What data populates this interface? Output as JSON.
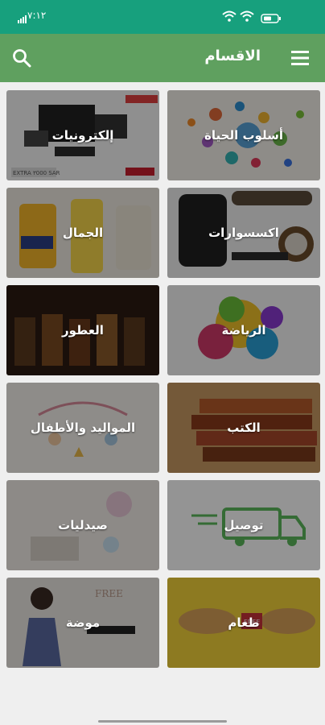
{
  "status": {
    "time": "٧:١٢",
    "battery_icon": "battery-icon",
    "wifi_icon": "wifi-icon",
    "signal_icon": "signal-icon"
  },
  "app_bar": {
    "title": "الاقسام",
    "search_icon": "search-icon",
    "menu_icon": "menu-icon"
  },
  "categories": [
    {
      "label": "أسلوب الحياة"
    },
    {
      "label": "إلكترونيات"
    },
    {
      "label": "اكسسوارات"
    },
    {
      "label": "الجمال"
    },
    {
      "label": "الرياضة"
    },
    {
      "label": "العطور"
    },
    {
      "label": "الكتب"
    },
    {
      "label": "المواليد والأطفال"
    },
    {
      "label": "توصيل"
    },
    {
      "label": "صيدليات"
    },
    {
      "label": "طعام"
    },
    {
      "label": "موضة"
    }
  ],
  "image_texts": {
    "electronics_sale": "EXTRA ٣000 SAR",
    "food_badge": "FREE",
    "fashion_sale": "FREE"
  },
  "colors": {
    "status_bar": "#17a07d",
    "app_bar": "#5fa05f",
    "background": "#efefef"
  }
}
